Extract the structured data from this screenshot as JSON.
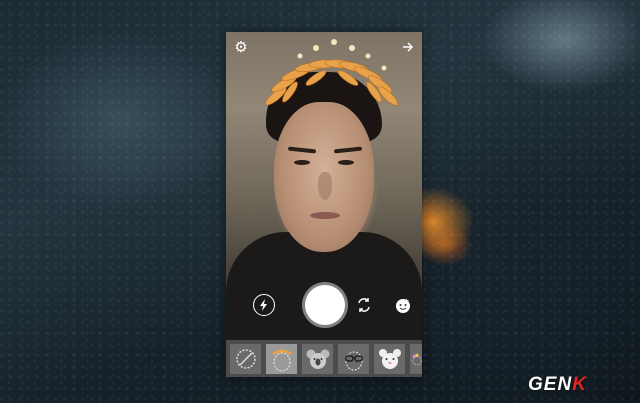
{
  "app": {
    "top_bar": {
      "settings_icon": "gear-icon",
      "next_icon": "arrow-right-icon"
    },
    "camera_controls": {
      "flash_icon": "lightning-icon",
      "shutter": "capture-button",
      "flip_icon": "camera-flip-icon",
      "face_filter_icon": "face-filter-icon"
    },
    "filters": [
      {
        "name": "none",
        "icon": "no-filter-icon",
        "selected": false
      },
      {
        "name": "crown",
        "icon": "crown-filter-icon",
        "selected": true
      },
      {
        "name": "koala",
        "icon": "koala-filter-icon",
        "selected": false
      },
      {
        "name": "glasses",
        "icon": "glasses-filter-icon",
        "selected": false
      },
      {
        "name": "bunny",
        "icon": "bunny-filter-icon",
        "selected": false
      },
      {
        "name": "flowers",
        "icon": "flower-filter-icon",
        "selected": false
      }
    ]
  },
  "watermark": {
    "part1": "GEN",
    "part2": "K"
  },
  "colors": {
    "accent": "#e02525",
    "tray": "#4c4c4c"
  }
}
